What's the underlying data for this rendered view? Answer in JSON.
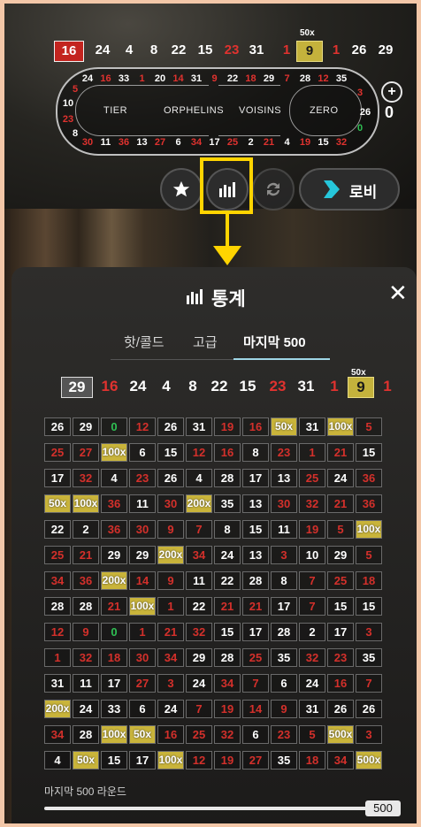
{
  "colors": {
    "red": "#e0322f",
    "green": "#2fbf53",
    "multiplier": "#c9b43a",
    "highlight": "#ffd400"
  },
  "top_history": {
    "multiplier_tag": "50x",
    "numbers": [
      {
        "v": "16",
        "c": "first"
      },
      {
        "v": "24",
        "c": "black"
      },
      {
        "v": "4",
        "c": "black"
      },
      {
        "v": "8",
        "c": "black"
      },
      {
        "v": "22",
        "c": "black"
      },
      {
        "v": "15",
        "c": "black"
      },
      {
        "v": "23",
        "c": "red"
      },
      {
        "v": "31",
        "c": "black"
      },
      {
        "v": "1",
        "c": "red"
      },
      {
        "v": "9",
        "c": "mult"
      },
      {
        "v": "1",
        "c": "red"
      },
      {
        "v": "26",
        "c": "black"
      },
      {
        "v": "29",
        "c": "black"
      }
    ]
  },
  "racetrack": {
    "top_row": [
      {
        "v": "24",
        "c": "black"
      },
      {
        "v": "16",
        "c": "red"
      },
      {
        "v": "33",
        "c": "black"
      },
      {
        "v": "1",
        "c": "red"
      },
      {
        "v": "20",
        "c": "black"
      },
      {
        "v": "14",
        "c": "red"
      },
      {
        "v": "31",
        "c": "black"
      },
      {
        "v": "9",
        "c": "red"
      },
      {
        "v": "22",
        "c": "black"
      },
      {
        "v": "18",
        "c": "red"
      },
      {
        "v": "29",
        "c": "black"
      },
      {
        "v": "7",
        "c": "red"
      },
      {
        "v": "28",
        "c": "black"
      },
      {
        "v": "12",
        "c": "red"
      },
      {
        "v": "35",
        "c": "black"
      }
    ],
    "bottom_row": [
      {
        "v": "30",
        "c": "red"
      },
      {
        "v": "11",
        "c": "black"
      },
      {
        "v": "36",
        "c": "red"
      },
      {
        "v": "13",
        "c": "black"
      },
      {
        "v": "27",
        "c": "red"
      },
      {
        "v": "6",
        "c": "black"
      },
      {
        "v": "34",
        "c": "red"
      },
      {
        "v": "17",
        "c": "black"
      },
      {
        "v": "25",
        "c": "red"
      },
      {
        "v": "2",
        "c": "black"
      },
      {
        "v": "21",
        "c": "red"
      },
      {
        "v": "4",
        "c": "black"
      },
      {
        "v": "19",
        "c": "red"
      },
      {
        "v": "15",
        "c": "black"
      },
      {
        "v": "32",
        "c": "red"
      }
    ],
    "left_end": [
      {
        "v": "5",
        "c": "red"
      },
      {
        "v": "10",
        "c": "black"
      },
      {
        "v": "23",
        "c": "red"
      },
      {
        "v": "8",
        "c": "black"
      }
    ],
    "right_end": [
      {
        "v": "3",
        "c": "red"
      },
      {
        "v": "26",
        "c": "black"
      },
      {
        "v": "0",
        "c": "green"
      }
    ],
    "labels": {
      "tier": "TIER",
      "orphelins": "ORPHELINS",
      "voisins": "VOISINS",
      "zero": "ZERO"
    }
  },
  "controls": {
    "zero_count": "0",
    "lobby_label": "로비",
    "plus_glyph": "+",
    "favorite_icon": "star-icon",
    "stats_icon": "bar-chart-icon",
    "repeat_icon": "repeat-icon"
  },
  "panel": {
    "title": "통계",
    "close_glyph": "✕",
    "tabs": [
      "핫/콜드",
      "고급",
      "마지막 500"
    ],
    "active_tab": 2,
    "multiplier_tag": "50x",
    "history": [
      {
        "v": "29",
        "c": "first"
      },
      {
        "v": "16",
        "c": "red"
      },
      {
        "v": "24",
        "c": "black"
      },
      {
        "v": "4",
        "c": "black"
      },
      {
        "v": "8",
        "c": "black"
      },
      {
        "v": "22",
        "c": "black"
      },
      {
        "v": "15",
        "c": "black"
      },
      {
        "v": "23",
        "c": "red"
      },
      {
        "v": "31",
        "c": "black"
      },
      {
        "v": "1",
        "c": "red"
      },
      {
        "v": "9",
        "c": "mult"
      },
      {
        "v": "1",
        "c": "red"
      }
    ],
    "grid": [
      [
        "26",
        "29",
        "0g",
        "12r",
        "26",
        "31",
        "19r",
        "16r",
        "50x",
        "31",
        "100x",
        "5r"
      ],
      [
        "25r",
        "27r",
        "100x",
        "6",
        "15",
        "12r",
        "16r",
        "8",
        "23r",
        "1r",
        "21r",
        "15"
      ],
      [
        "17",
        "32r",
        "4",
        "23r",
        "26",
        "4",
        "28",
        "17",
        "13",
        "25r",
        "24",
        "36r"
      ],
      [
        "50x",
        "100x",
        "36r",
        "11",
        "30r",
        "200x",
        "35",
        "13",
        "30r",
        "32r",
        "21r",
        "36r"
      ],
      [
        "22",
        "2",
        "36r",
        "30r",
        "9r",
        "7r",
        "8",
        "15",
        "11",
        "19r",
        "5r",
        "100x"
      ],
      [
        "25r",
        "21r",
        "29",
        "29",
        "200x",
        "34r",
        "24",
        "13",
        "3r",
        "10",
        "29",
        "5r"
      ],
      [
        "34r",
        "36r",
        "200x",
        "14r",
        "9r",
        "11",
        "22",
        "28",
        "8",
        "7r",
        "25r",
        "18r"
      ],
      [
        "28",
        "28",
        "21r",
        "100x",
        "1r",
        "22",
        "21r",
        "21r",
        "17",
        "7r",
        "15",
        "15"
      ],
      [
        "12r",
        "9r",
        "0g",
        "1r",
        "21r",
        "32r",
        "15",
        "17",
        "28",
        "2",
        "17",
        "3r"
      ],
      [
        "1r",
        "32r",
        "18r",
        "30r",
        "34r",
        "29",
        "28",
        "25r",
        "35",
        "32r",
        "23r",
        "35"
      ],
      [
        "31",
        "11",
        "17",
        "27r",
        "3r",
        "24",
        "34r",
        "7r",
        "6",
        "24",
        "16r",
        "7r"
      ],
      [
        "200x",
        "24",
        "33",
        "6",
        "24",
        "7r",
        "19r",
        "14r",
        "9r",
        "31",
        "26",
        "26"
      ],
      [
        "34r",
        "28",
        "100x",
        "50x",
        "16r",
        "25r",
        "32r",
        "6",
        "23r",
        "5r",
        "500x",
        "3r"
      ],
      [
        "4",
        "50x",
        "15",
        "17",
        "100x",
        "12r",
        "19r",
        "27r",
        "35",
        "18r",
        "34r",
        "500x"
      ]
    ],
    "rounds_label": "마지막 500 라운드",
    "rounds_value": "500"
  }
}
